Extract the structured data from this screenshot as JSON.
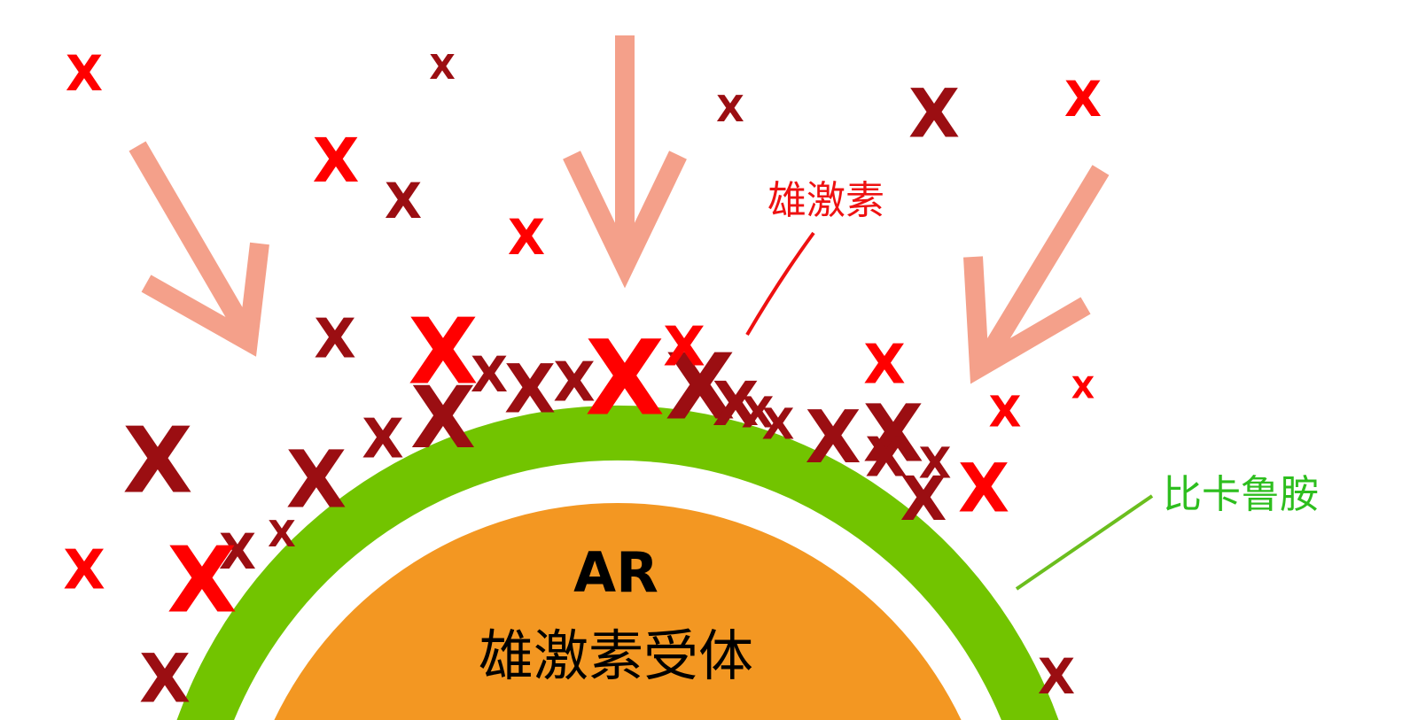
{
  "labels": {
    "androgen": "雄激素",
    "bicalutamide": "比卡鲁胺",
    "ar_abbrev": "AR",
    "ar_full": "雄激素受体"
  },
  "colors": {
    "androgen_bright": "#FF0000",
    "androgen_dark": "#9B0E12",
    "arrow": "#F4A08A",
    "bicalutamide_layer": "#72C400",
    "receptor": "#F39722",
    "androgen_label": "#EE1111",
    "bicalutamide_label": "#2DBE1E"
  }
}
